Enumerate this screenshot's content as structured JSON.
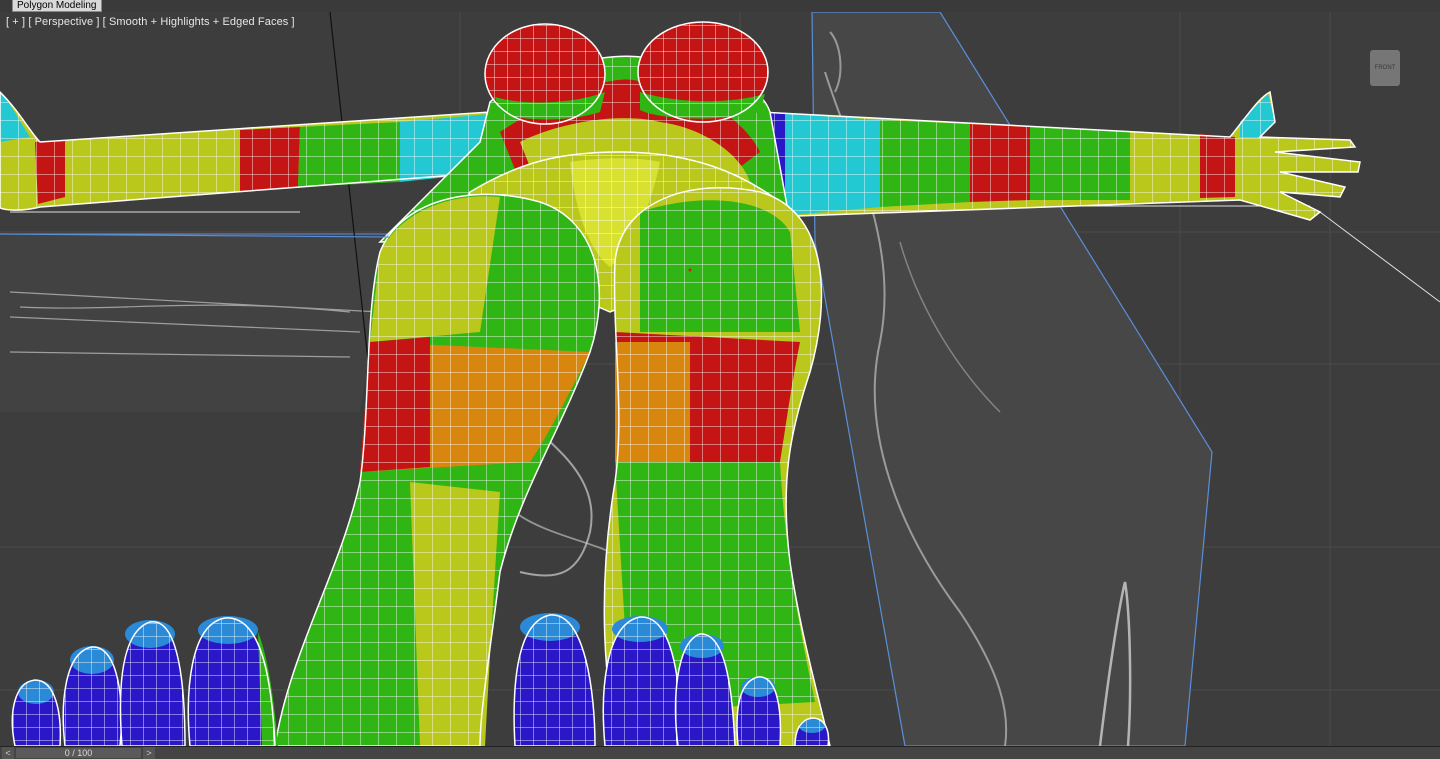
{
  "ribbon": {
    "active_tab": "Polygon Modeling"
  },
  "viewport": {
    "label_plus": "[ + ]",
    "label_view": "[ Perspective ]",
    "label_shading": "[ Smooth + Highlights + Edged Faces ]",
    "viewcube_text": "FRONT"
  },
  "timeslider": {
    "value": "0 / 100",
    "prev_label": "<",
    "next_label": ">"
  },
  "colors": {
    "viewport_bg": "#3d3d3d",
    "wire": "#ffffff",
    "green": "#2fb514",
    "yellow_green": "#b9c81a",
    "red": "#c41414",
    "orange": "#d8860e",
    "cyan": "#22c8d2",
    "blue": "#2a18c8"
  }
}
